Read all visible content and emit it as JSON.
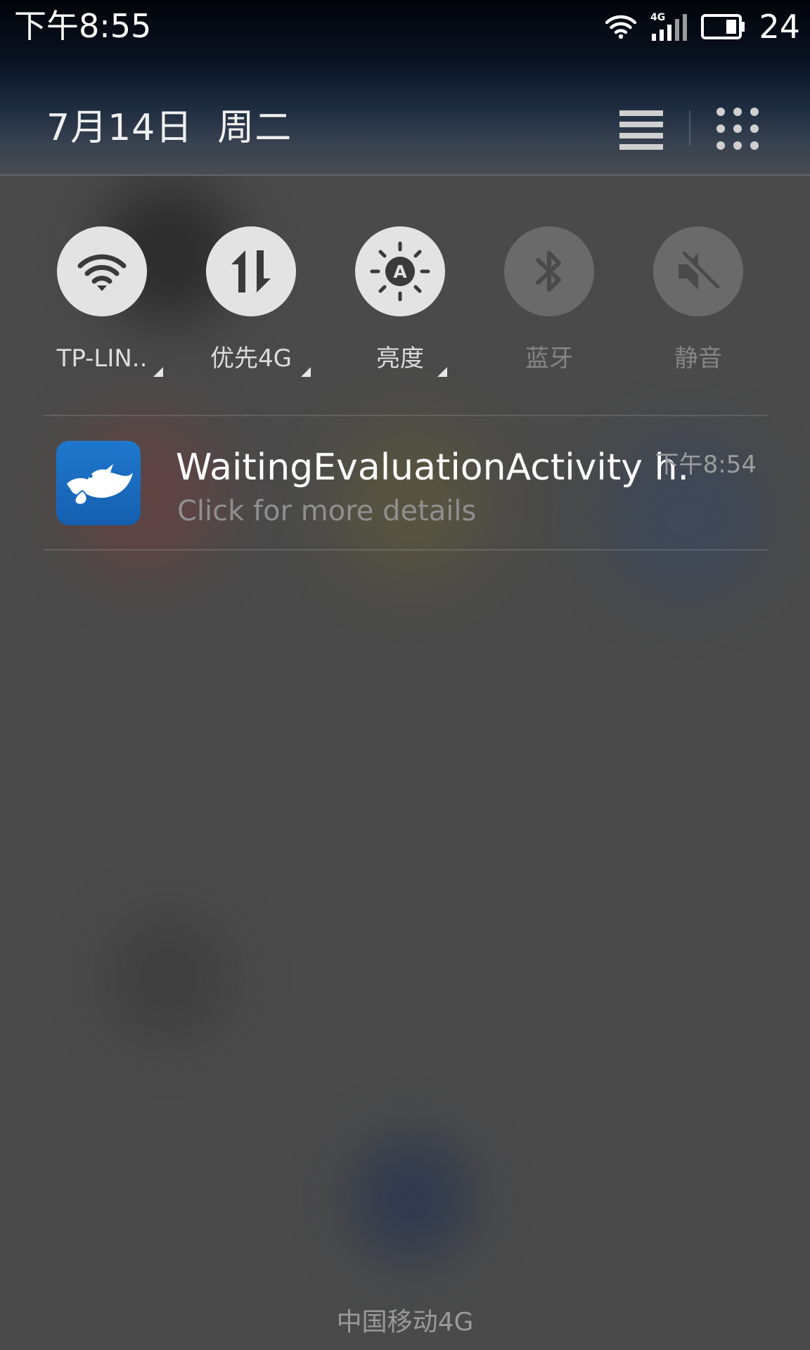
{
  "status_bar": {
    "time": "下午8:55",
    "network_type": "4G",
    "battery_level": "24",
    "icons": [
      "wifi-icon",
      "cellular-signal-icon",
      "battery-icon"
    ]
  },
  "header": {
    "date": "7月14日  周二",
    "buttons": {
      "list": "list-view-icon",
      "grid": "apps-grid-icon"
    }
  },
  "quick_toggles": [
    {
      "label": "TP-LIN..",
      "icon": "wifi-icon",
      "active": true,
      "has_options": true
    },
    {
      "label": "优先4G",
      "icon": "data-transfer-icon",
      "active": true,
      "has_options": true
    },
    {
      "label": "亮度",
      "icon": "auto-brightness-icon",
      "active": true,
      "has_options": true
    },
    {
      "label": "蓝牙",
      "icon": "bluetooth-icon",
      "active": false,
      "has_options": false
    },
    {
      "label": "静音",
      "icon": "mute-icon",
      "active": false,
      "has_options": false
    }
  ],
  "notification": {
    "app_icon": "dove-app-icon",
    "title": "WaitingEvaluationActivity h..",
    "time": "下午8:54",
    "body": "Click for more details"
  },
  "carrier": "中国移动4G",
  "colors": {
    "toggle_on": "#e3e3e3",
    "toggle_off": "#6a6a6a",
    "app_icon_blue": "#1a6cc0",
    "background": "#4a4a4a"
  }
}
